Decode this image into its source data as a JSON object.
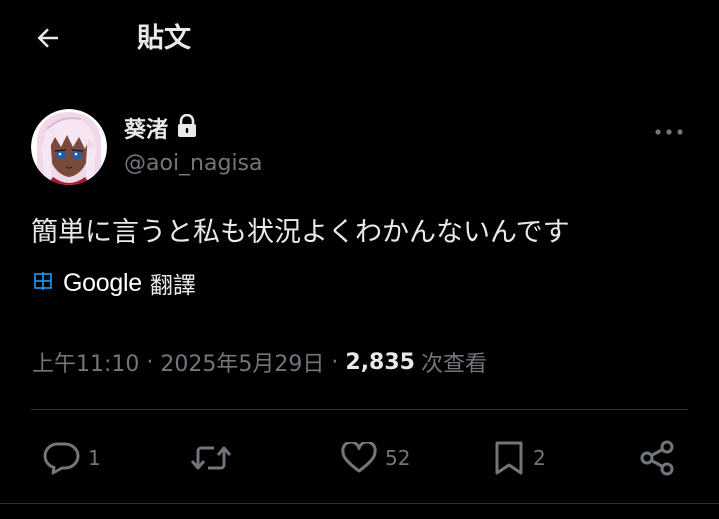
{
  "header": {
    "back_icon": "arrow-left-icon",
    "title": "貼文"
  },
  "post": {
    "author": {
      "display_name": "葵渚",
      "protected_icon": "lock-icon",
      "handle": "@aoi_nagisa",
      "avatar_icon": "avatar-image"
    },
    "more_icon": "more-horizontal-icon",
    "text": "簡単に言うと私も状況よくわかんないんです",
    "translate": {
      "icon": "translate-icon",
      "provider": "Google",
      "label": "翻譯"
    },
    "meta": {
      "time": "上午11:10",
      "separator": "·",
      "date": "2025年5月29日",
      "views_count": "2,835",
      "views_label": "次查看"
    },
    "actions": {
      "reply": {
        "icon": "reply-icon",
        "count": "1"
      },
      "repost": {
        "icon": "repost-icon",
        "count": ""
      },
      "like": {
        "icon": "heart-icon",
        "count": "52"
      },
      "bookmark": {
        "icon": "bookmark-icon",
        "count": "2"
      },
      "share": {
        "icon": "share-icon",
        "count": ""
      }
    }
  },
  "colors": {
    "background": "#000000",
    "text_primary": "#e7e9ea",
    "text_secondary": "#71767b",
    "divider": "#2f3336",
    "translate_icon": "#1d9bf0"
  }
}
